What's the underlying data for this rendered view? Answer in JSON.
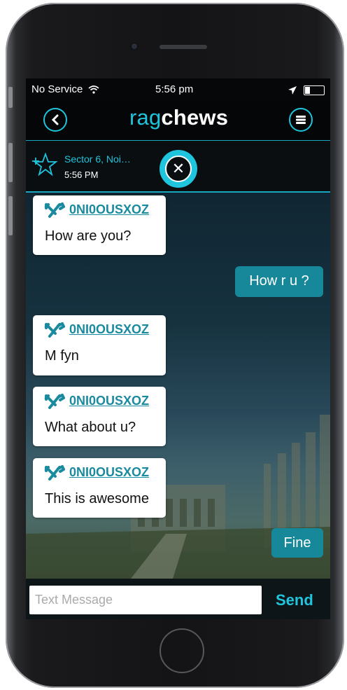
{
  "status_bar": {
    "carrier": "No Service",
    "time": "5:56 pm"
  },
  "header": {
    "title_light": "rag",
    "title_bold": "chews",
    "back_icon": "chevron-left-icon",
    "menu_icon": "menu-icon"
  },
  "location": {
    "name": "Sector 6, Noi…",
    "time": "5:56 PM",
    "star_icon": "star-plus-icon",
    "close_icon": "close-icon"
  },
  "messages": [
    {
      "direction": "in",
      "sender": "0NI0OUSXOZ",
      "text": "How are you?"
    },
    {
      "direction": "out",
      "text": "How r u ?"
    },
    {
      "direction": "in",
      "sender": "0NI0OUSXOZ",
      "text": "M fyn"
    },
    {
      "direction": "in",
      "sender": "0NI0OUSXOZ",
      "text": "What about u?"
    },
    {
      "direction": "in",
      "sender": "0NI0OUSXOZ",
      "text": "This is awesome"
    },
    {
      "direction": "out",
      "text": "Fine"
    }
  ],
  "composer": {
    "placeholder": "Text Message",
    "value": "",
    "send_label": "Send"
  },
  "colors": {
    "accent": "#1fc4dd",
    "outgoing_bubble": "#17889a",
    "incoming_bubble": "#ffffff"
  }
}
